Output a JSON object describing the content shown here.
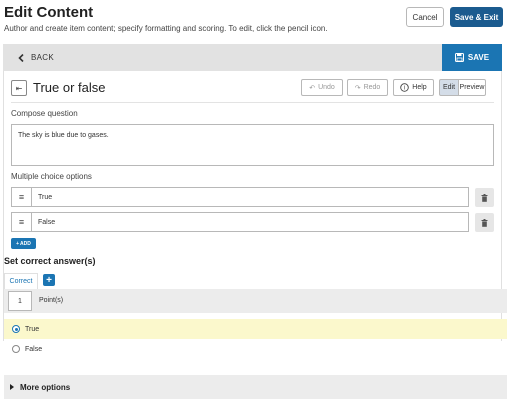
{
  "header": {
    "title": "Edit Content",
    "subtitle": "Author and create item content; specify formatting and scoring. To edit, click the pencil icon.",
    "cancel_label": "Cancel",
    "save_exit_label": "Save & Exit"
  },
  "toolbar": {
    "back_label": "BACK",
    "save_label": "SAVE"
  },
  "question": {
    "type_title": "True or false",
    "undo_label": "Undo",
    "redo_label": "Redo",
    "help_label": "Help",
    "edit_label": "Edit",
    "preview_label": "Preview",
    "mode_selected": "Edit"
  },
  "compose": {
    "label": "Compose question",
    "text": "The sky is blue due to gases."
  },
  "options": {
    "label": "Multiple choice options",
    "items": [
      {
        "text": "True"
      },
      {
        "text": "False"
      }
    ],
    "add_label": "ADD"
  },
  "correct": {
    "title": "Set correct answer(s)",
    "tab_label": "Correct",
    "points_value": "1",
    "points_label": "Point(s)",
    "answers": [
      {
        "text": "True",
        "selected": true
      },
      {
        "text": "False",
        "selected": false
      }
    ]
  },
  "more": {
    "label": "More options"
  },
  "colors": {
    "primary": "#1b5b8f",
    "accent": "#1b75b3",
    "selected_row": "#fbf8cc"
  }
}
